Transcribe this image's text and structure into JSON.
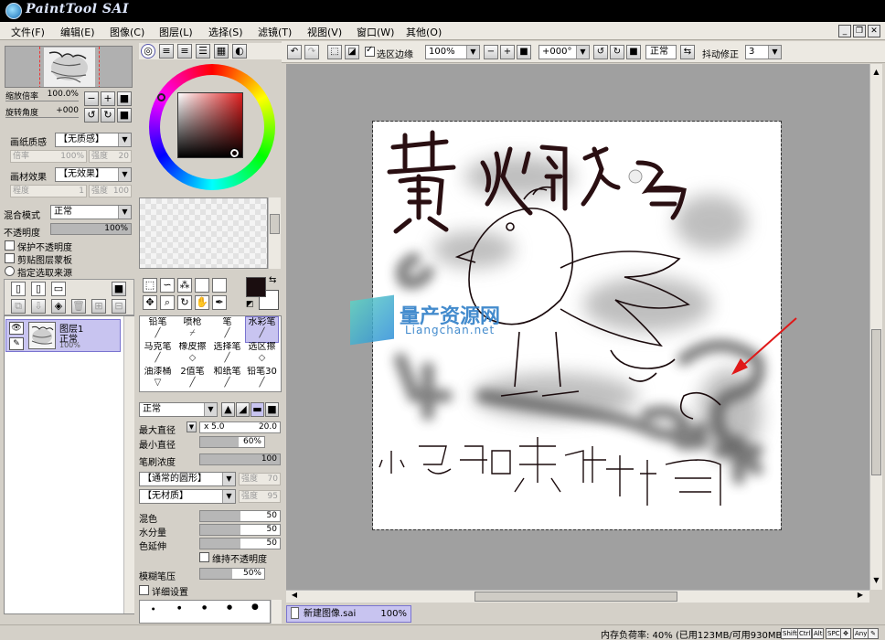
{
  "app": {
    "title": "PaintTool SAI"
  },
  "menu": [
    "文件(F)",
    "编辑(E)",
    "图像(C)",
    "图层(L)",
    "选择(S)",
    "滤镜(T)",
    "视图(V)",
    "窗口(W)",
    "其他(O)"
  ],
  "navigator": {
    "zoom_label": "缩放倍率",
    "zoom_value": "100.0%",
    "rotate_label": "旋转角度",
    "rotate_value": "+000"
  },
  "paper": {
    "texture_label": "画纸质感",
    "texture_value": "【无质感】",
    "scale_label": "倍率",
    "scale_value": "100%",
    "strength_label": "强度",
    "strength_value": "20",
    "effect_label": "画材效果",
    "effect_value": "【无效果】",
    "degree_label": "程度",
    "degree_value": "1",
    "effect_strength_label": "强度",
    "effect_strength_value": "100"
  },
  "layer_props": {
    "blend_label": "混合模式",
    "blend_value": "正常",
    "opacity_label": "不透明度",
    "opacity_value": "100%",
    "opacity": 1.0,
    "protect_opacity": "保护不透明度",
    "clip_mask": "剪贴图层蒙板",
    "selection_source": "指定选取来源"
  },
  "layers": [
    {
      "name": "图层1",
      "mode": "正常",
      "opacity": "100%"
    }
  ],
  "tools": [
    {
      "label": "铅笔",
      "selected": false
    },
    {
      "label": "喷枪",
      "selected": false
    },
    {
      "label": "笔",
      "selected": false
    },
    {
      "label": "水彩笔",
      "selected": true
    },
    {
      "label": "马克笔",
      "selected": false
    },
    {
      "label": "橡皮擦",
      "selected": false
    },
    {
      "label": "选择笔",
      "selected": false
    },
    {
      "label": "选区擦",
      "selected": false
    },
    {
      "label": "油漆桶",
      "selected": false
    },
    {
      "label": "2值笔",
      "selected": false
    },
    {
      "label": "和纸笔",
      "selected": false
    },
    {
      "label": "铅笔30",
      "selected": false
    }
  ],
  "brush": {
    "mode_value": "正常",
    "max_size_label": "最大直径",
    "max_size_mult": "x 5.0",
    "max_size_value": "20.0",
    "min_size_label": "最小直径",
    "min_size_value": "60%",
    "min_size": 0.6,
    "density_label": "笔刷浓度",
    "density_value": "100",
    "density": 1.0,
    "shape_value": "【通常的圆形】",
    "shape_strength_label": "强度",
    "shape_strength_value": "70",
    "texture_value": "【无材质】",
    "texture_strength_label": "强度",
    "texture_strength_value": "95",
    "blend_label": "混色",
    "blend_value": "50",
    "blend": 0.5,
    "water_label": "水分量",
    "water_value": "50",
    "water": 0.5,
    "extend_label": "色延伸",
    "extend_value": "50",
    "extend": 0.5,
    "keep_opacity": "维持不透明度",
    "blur_label": "模糊笔压",
    "blur_value": "50%",
    "blur": 0.5,
    "detail_label": "详细设置"
  },
  "toolbar": {
    "selection_edge": "选区边缘",
    "zoom_value": "100%",
    "angle_value": "+000°",
    "mode_value": "正常",
    "stabilizer_label": "抖动修正",
    "stabilizer_value": "3"
  },
  "canvas": {
    "title_text": "黄焖鸡",
    "bottom_text": "小鸡啄米图",
    "watermark_cn": "量产资源网",
    "watermark_en": "Liangchan.net"
  },
  "document_tab": {
    "name": "新建图像.sai",
    "zoom": "100%"
  },
  "status": {
    "memory": "内存负荷率: 40% (已用123MB/可用930MB)",
    "keys": [
      "Shift",
      "Ctrl",
      "Alt",
      "SPC",
      "Any"
    ]
  },
  "colors": {
    "accent_selected": "#c8c4f0",
    "foreground_color": "#1a0d0f",
    "panel_bg": "#d4d0c8",
    "canvas_bg": "#a0a0a0"
  }
}
